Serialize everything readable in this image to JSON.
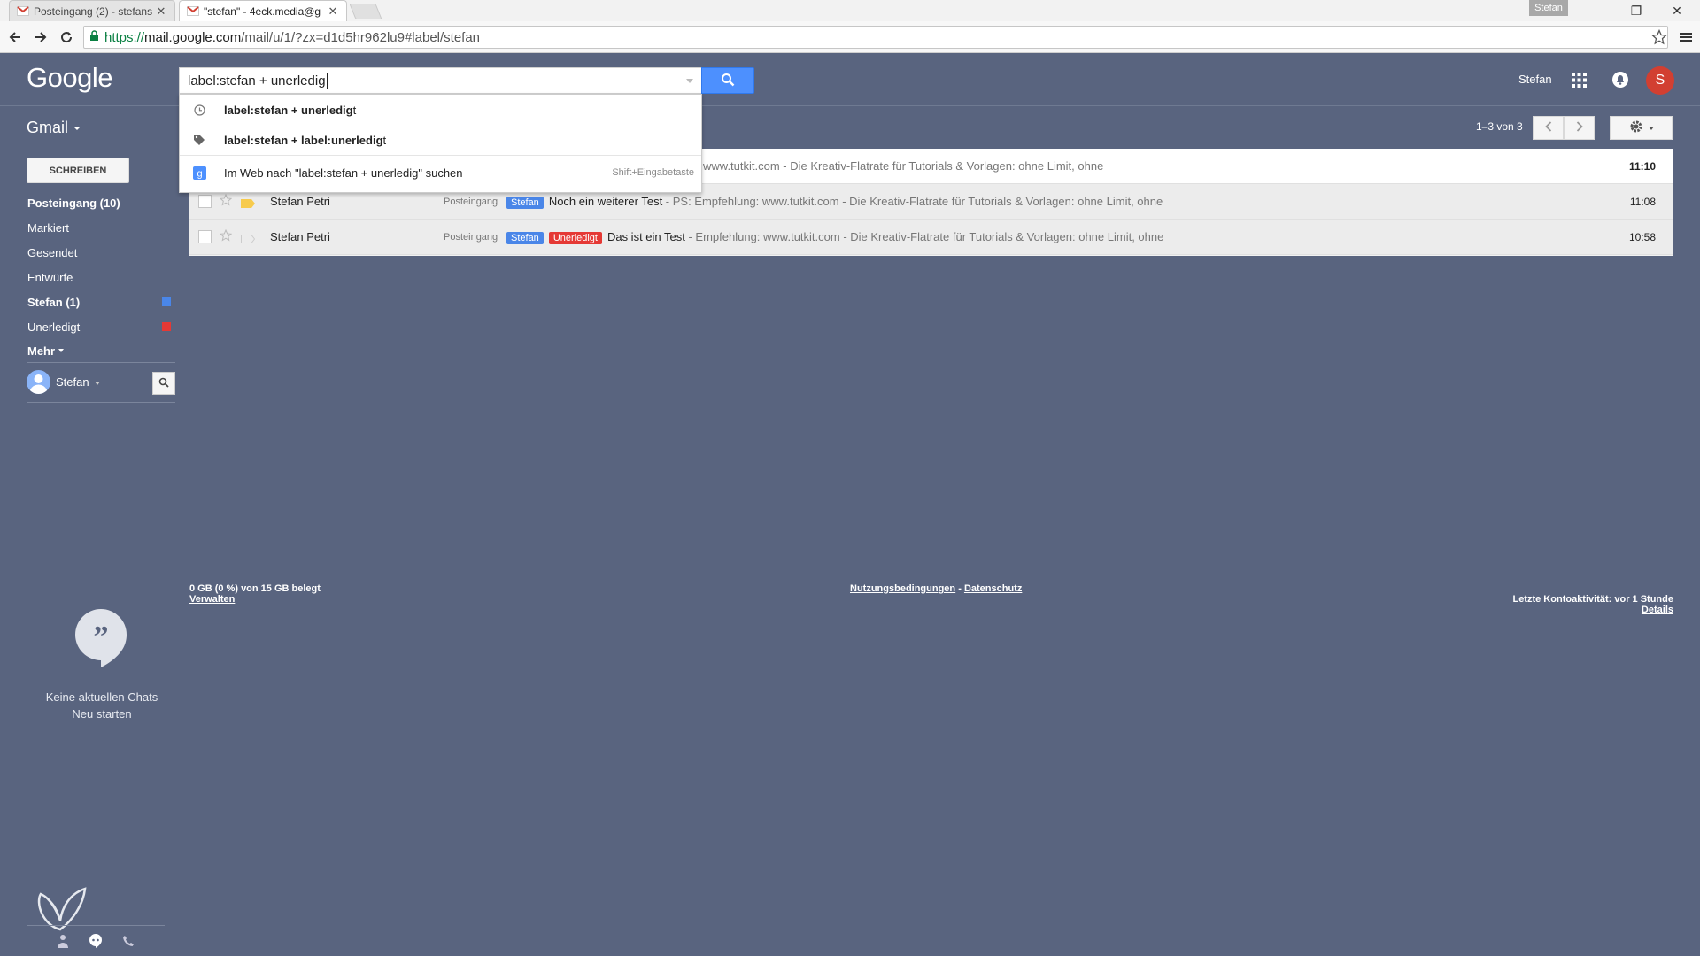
{
  "browser": {
    "tabs": [
      {
        "title": "Posteingang (2) - stefans",
        "active": false
      },
      {
        "title": "\"stefan\" - 4eck.media@g",
        "active": true
      }
    ],
    "profile_badge": "Stefan",
    "url": {
      "scheme": "https://",
      "host": "mail.google.com",
      "path": "/mail/u/1/?zx=d1d5hr962lu9#label/stefan"
    }
  },
  "header": {
    "logo": "Google",
    "search_value": "label:stefan + unerledig",
    "user_name": "Stefan",
    "avatar_letter": "S"
  },
  "suggestions": [
    {
      "bold": "label:stefan + unerledig",
      "rest": "t",
      "icon": "clock-icon"
    },
    {
      "bold": "label:stefan + label:unerledig",
      "rest": "t",
      "icon": "tag-icon"
    },
    {
      "text": "Im Web nach \"label:stefan + unerledig\" suchen",
      "hint": "Shift+Eingabetaste",
      "icon": "google-icon"
    }
  ],
  "nav": {
    "gmail_label": "Gmail",
    "compose": "SCHREIBEN",
    "items": [
      {
        "label": "Posteingang (10)",
        "bold": true
      },
      {
        "label": "Markiert",
        "bold": false
      },
      {
        "label": "Gesendet",
        "bold": false
      },
      {
        "label": "Entwürfe",
        "bold": false
      },
      {
        "label": "Stefan (1)",
        "bold": true,
        "color": "#4a86e8"
      },
      {
        "label": "Unerledigt",
        "bold": false,
        "color": "#e53935"
      },
      {
        "label": "Mehr",
        "bold": true
      }
    ],
    "hangouts_user": "Stefan",
    "chat_empty": "Keine aktuellen Chats",
    "chat_start": "Neu starten"
  },
  "toolbar": {
    "pager": "1–3 von 3"
  },
  "messages": [
    {
      "sender": "",
      "category": "",
      "labels": [],
      "subject": "",
      "snippet": "www.tutkit.com - Die Kreativ-Flatrate für Tutorials & Vorlagen: ohne Limit, ohne",
      "time": "11:10",
      "unread": true
    },
    {
      "sender": "Stefan Petri",
      "category": "Posteingang",
      "labels": [
        {
          "name": "Stefan",
          "color": "#4a86e8"
        }
      ],
      "subject": "Noch ein weiterer Test",
      "snippet": " - PS: Empfehlung: www.tutkit.com - Die Kreativ-Flatrate für Tutorials & Vorlagen: ohne Limit, ohne",
      "time": "11:08",
      "unread": false
    },
    {
      "sender": "Stefan Petri",
      "category": "Posteingang",
      "labels": [
        {
          "name": "Stefan",
          "color": "#4a86e8"
        },
        {
          "name": "Unerledigt",
          "color": "#e53935"
        }
      ],
      "subject": "Das ist ein Test",
      "snippet": " - Empfehlung: www.tutkit.com - Die Kreativ-Flatrate für Tutorials & Vorlagen: ohne Limit, ohne",
      "time": "10:58",
      "unread": false
    }
  ],
  "footer": {
    "storage": "0 GB (0 %) von 15 GB belegt",
    "manage": "Verwalten",
    "terms": "Nutzungsbedingungen",
    "sep": " - ",
    "privacy": "Datenschutz",
    "activity": "Letzte Kontoaktivität: vor 1 Stunde",
    "details": "Details"
  }
}
